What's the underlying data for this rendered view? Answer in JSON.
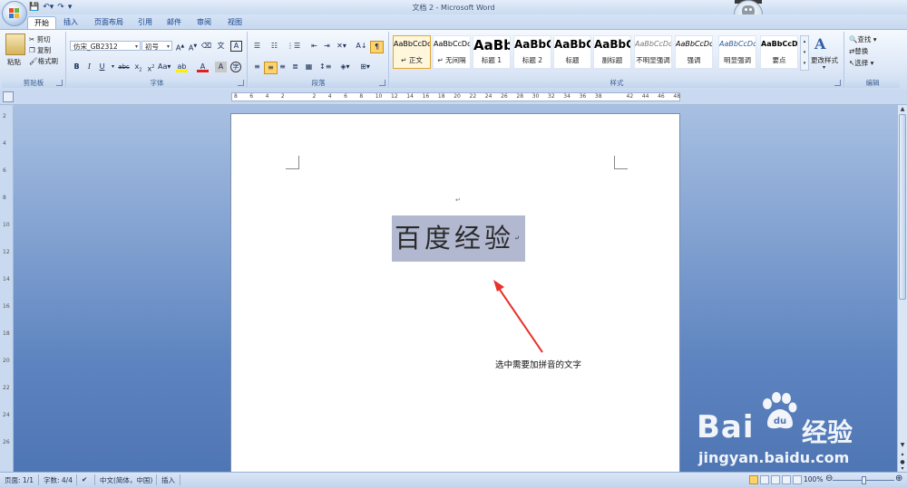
{
  "window": {
    "title": "文档 2 - Microsoft Word",
    "qat_icons": [
      "save-icon",
      "undo-icon",
      "redo-icon",
      "customize-icon"
    ]
  },
  "tabs": [
    "开始",
    "插入",
    "页面布局",
    "引用",
    "邮件",
    "审阅",
    "视图"
  ],
  "ribbon": {
    "clipboard": {
      "label": "剪贴板",
      "paste": "粘贴",
      "cut": "剪切",
      "copy": "复制",
      "format_painter": "格式刷"
    },
    "font": {
      "label": "字体",
      "font_name": "仿宋_GB2312",
      "font_size": "初号"
    },
    "paragraph": {
      "label": "段落"
    },
    "styles": {
      "label": "样式",
      "items": [
        {
          "sample": "AaBbCcDd",
          "name": "↵ 正文"
        },
        {
          "sample": "AaBbCcDd",
          "name": "↵ 无间隔"
        },
        {
          "sample": "AaBb",
          "name": "标题 1"
        },
        {
          "sample": "AaBbC",
          "name": "标题 2"
        },
        {
          "sample": "AaBbC",
          "name": "标题"
        },
        {
          "sample": "AaBbC",
          "name": "副标题"
        },
        {
          "sample": "AaBbCcDd",
          "name": "不明显强调"
        },
        {
          "sample": "AaBbCcDd",
          "name": "强调"
        },
        {
          "sample": "AaBbCcDd",
          "name": "明显强调"
        },
        {
          "sample": "AaBbCcDd",
          "name": "要点"
        }
      ],
      "change_styles": "更改样式"
    },
    "editing": {
      "label": "编辑",
      "find": "查找",
      "replace": "替换",
      "select": "选择"
    }
  },
  "ruler": {
    "h_ticks": [
      "8",
      "6",
      "4",
      "2",
      "",
      "2",
      "4",
      "6",
      "8",
      "10",
      "12",
      "14",
      "16",
      "18",
      "20",
      "22",
      "24",
      "26",
      "28",
      "30",
      "32",
      "34",
      "36",
      "38",
      "",
      "42",
      "44",
      "46",
      "48"
    ],
    "v_ticks": [
      "2",
      "4",
      "6",
      "8",
      "10",
      "12",
      "14",
      "16",
      "18",
      "20",
      "22",
      "24",
      "26"
    ]
  },
  "document": {
    "selected_text": "百度经验",
    "annotation": "选中需要加拼音的文字",
    "para_mark": "↵"
  },
  "watermark": {
    "brand": "Bai",
    "brand_cn": "经验",
    "url": "jingyan.baidu.com"
  },
  "status": {
    "page": "页面: 1/1",
    "words": "字数: 4/4",
    "language": "中文(简体，中国)",
    "mode": "插入",
    "zoom": "100%"
  },
  "colors": {
    "accent": "#15428b",
    "selection": "#b2b8cf",
    "annotation_arrow": "#e8322b"
  }
}
